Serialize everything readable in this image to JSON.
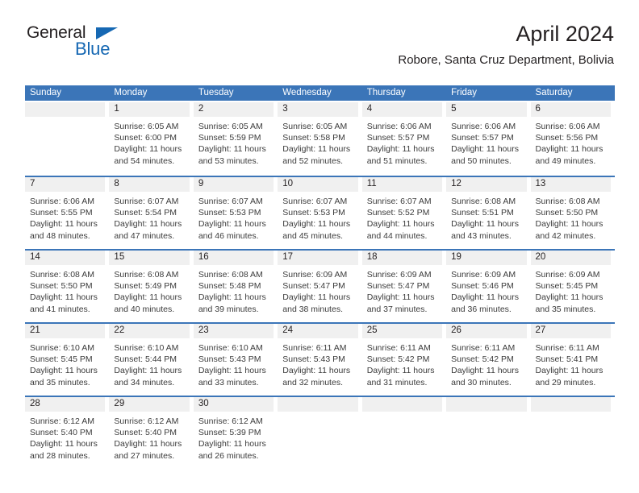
{
  "brand": {
    "name_part1": "General",
    "name_part2": "Blue",
    "triangle_color": "#1668b3"
  },
  "header": {
    "title": "April 2024",
    "subtitle": "Robore, Santa Cruz Department, Bolivia",
    "accent_color": "#3b75b8",
    "date_strip_color": "#f0f0f0"
  },
  "calendar": {
    "day_headers": [
      "Sunday",
      "Monday",
      "Tuesday",
      "Wednesday",
      "Thursday",
      "Friday",
      "Saturday"
    ],
    "weeks": [
      [
        {
          "date": "",
          "lines": []
        },
        {
          "date": "1",
          "lines": [
            "Sunrise: 6:05 AM",
            "Sunset: 6:00 PM",
            "Daylight: 11 hours",
            "and 54 minutes."
          ]
        },
        {
          "date": "2",
          "lines": [
            "Sunrise: 6:05 AM",
            "Sunset: 5:59 PM",
            "Daylight: 11 hours",
            "and 53 minutes."
          ]
        },
        {
          "date": "3",
          "lines": [
            "Sunrise: 6:05 AM",
            "Sunset: 5:58 PM",
            "Daylight: 11 hours",
            "and 52 minutes."
          ]
        },
        {
          "date": "4",
          "lines": [
            "Sunrise: 6:06 AM",
            "Sunset: 5:57 PM",
            "Daylight: 11 hours",
            "and 51 minutes."
          ]
        },
        {
          "date": "5",
          "lines": [
            "Sunrise: 6:06 AM",
            "Sunset: 5:57 PM",
            "Daylight: 11 hours",
            "and 50 minutes."
          ]
        },
        {
          "date": "6",
          "lines": [
            "Sunrise: 6:06 AM",
            "Sunset: 5:56 PM",
            "Daylight: 11 hours",
            "and 49 minutes."
          ]
        }
      ],
      [
        {
          "date": "7",
          "lines": [
            "Sunrise: 6:06 AM",
            "Sunset: 5:55 PM",
            "Daylight: 11 hours",
            "and 48 minutes."
          ]
        },
        {
          "date": "8",
          "lines": [
            "Sunrise: 6:07 AM",
            "Sunset: 5:54 PM",
            "Daylight: 11 hours",
            "and 47 minutes."
          ]
        },
        {
          "date": "9",
          "lines": [
            "Sunrise: 6:07 AM",
            "Sunset: 5:53 PM",
            "Daylight: 11 hours",
            "and 46 minutes."
          ]
        },
        {
          "date": "10",
          "lines": [
            "Sunrise: 6:07 AM",
            "Sunset: 5:53 PM",
            "Daylight: 11 hours",
            "and 45 minutes."
          ]
        },
        {
          "date": "11",
          "lines": [
            "Sunrise: 6:07 AM",
            "Sunset: 5:52 PM",
            "Daylight: 11 hours",
            "and 44 minutes."
          ]
        },
        {
          "date": "12",
          "lines": [
            "Sunrise: 6:08 AM",
            "Sunset: 5:51 PM",
            "Daylight: 11 hours",
            "and 43 minutes."
          ]
        },
        {
          "date": "13",
          "lines": [
            "Sunrise: 6:08 AM",
            "Sunset: 5:50 PM",
            "Daylight: 11 hours",
            "and 42 minutes."
          ]
        }
      ],
      [
        {
          "date": "14",
          "lines": [
            "Sunrise: 6:08 AM",
            "Sunset: 5:50 PM",
            "Daylight: 11 hours",
            "and 41 minutes."
          ]
        },
        {
          "date": "15",
          "lines": [
            "Sunrise: 6:08 AM",
            "Sunset: 5:49 PM",
            "Daylight: 11 hours",
            "and 40 minutes."
          ]
        },
        {
          "date": "16",
          "lines": [
            "Sunrise: 6:08 AM",
            "Sunset: 5:48 PM",
            "Daylight: 11 hours",
            "and 39 minutes."
          ]
        },
        {
          "date": "17",
          "lines": [
            "Sunrise: 6:09 AM",
            "Sunset: 5:47 PM",
            "Daylight: 11 hours",
            "and 38 minutes."
          ]
        },
        {
          "date": "18",
          "lines": [
            "Sunrise: 6:09 AM",
            "Sunset: 5:47 PM",
            "Daylight: 11 hours",
            "and 37 minutes."
          ]
        },
        {
          "date": "19",
          "lines": [
            "Sunrise: 6:09 AM",
            "Sunset: 5:46 PM",
            "Daylight: 11 hours",
            "and 36 minutes."
          ]
        },
        {
          "date": "20",
          "lines": [
            "Sunrise: 6:09 AM",
            "Sunset: 5:45 PM",
            "Daylight: 11 hours",
            "and 35 minutes."
          ]
        }
      ],
      [
        {
          "date": "21",
          "lines": [
            "Sunrise: 6:10 AM",
            "Sunset: 5:45 PM",
            "Daylight: 11 hours",
            "and 35 minutes."
          ]
        },
        {
          "date": "22",
          "lines": [
            "Sunrise: 6:10 AM",
            "Sunset: 5:44 PM",
            "Daylight: 11 hours",
            "and 34 minutes."
          ]
        },
        {
          "date": "23",
          "lines": [
            "Sunrise: 6:10 AM",
            "Sunset: 5:43 PM",
            "Daylight: 11 hours",
            "and 33 minutes."
          ]
        },
        {
          "date": "24",
          "lines": [
            "Sunrise: 6:11 AM",
            "Sunset: 5:43 PM",
            "Daylight: 11 hours",
            "and 32 minutes."
          ]
        },
        {
          "date": "25",
          "lines": [
            "Sunrise: 6:11 AM",
            "Sunset: 5:42 PM",
            "Daylight: 11 hours",
            "and 31 minutes."
          ]
        },
        {
          "date": "26",
          "lines": [
            "Sunrise: 6:11 AM",
            "Sunset: 5:42 PM",
            "Daylight: 11 hours",
            "and 30 minutes."
          ]
        },
        {
          "date": "27",
          "lines": [
            "Sunrise: 6:11 AM",
            "Sunset: 5:41 PM",
            "Daylight: 11 hours",
            "and 29 minutes."
          ]
        }
      ],
      [
        {
          "date": "28",
          "lines": [
            "Sunrise: 6:12 AM",
            "Sunset: 5:40 PM",
            "Daylight: 11 hours",
            "and 28 minutes."
          ]
        },
        {
          "date": "29",
          "lines": [
            "Sunrise: 6:12 AM",
            "Sunset: 5:40 PM",
            "Daylight: 11 hours",
            "and 27 minutes."
          ]
        },
        {
          "date": "30",
          "lines": [
            "Sunrise: 6:12 AM",
            "Sunset: 5:39 PM",
            "Daylight: 11 hours",
            "and 26 minutes."
          ]
        },
        {
          "date": "",
          "lines": []
        },
        {
          "date": "",
          "lines": []
        },
        {
          "date": "",
          "lines": []
        },
        {
          "date": "",
          "lines": []
        }
      ]
    ]
  }
}
